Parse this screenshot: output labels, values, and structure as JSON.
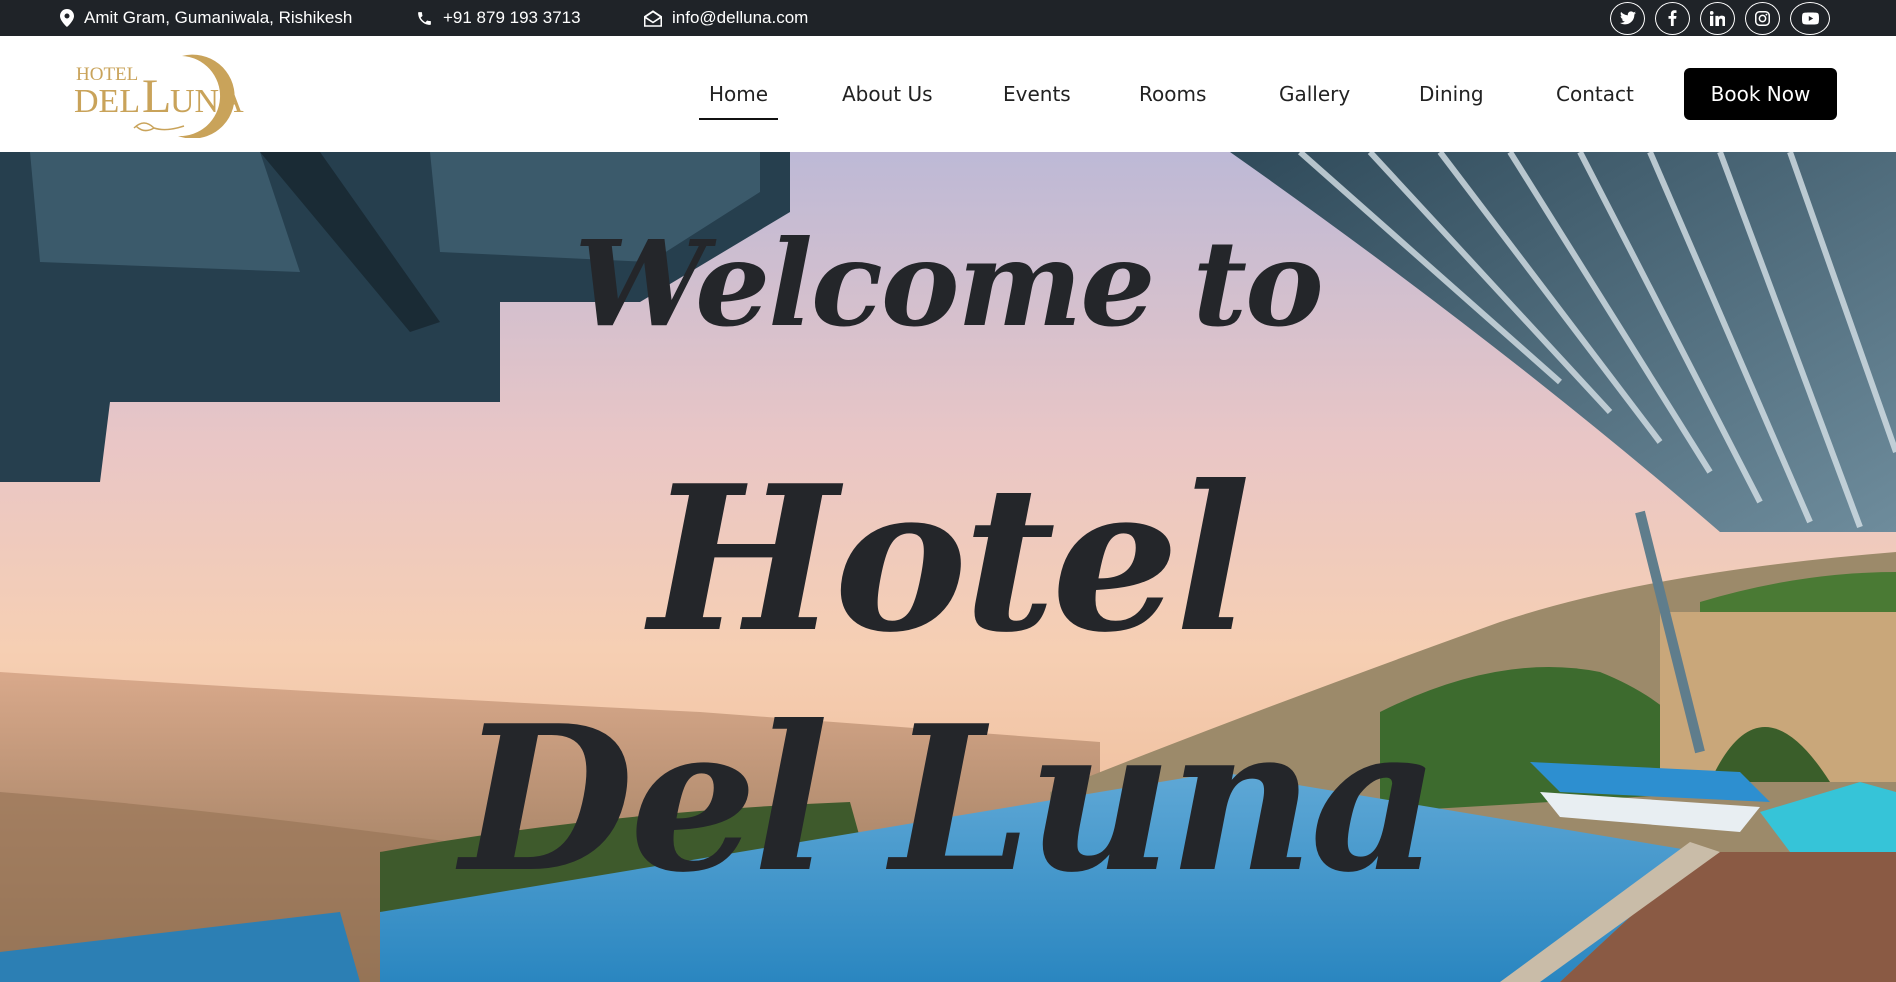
{
  "topbar": {
    "address": "Amit Gram, Gumaniwala, Rishikesh",
    "phone": "+91 879 193 3713",
    "email": "info@delluna.com",
    "socials": [
      "twitter-icon",
      "facebook-icon",
      "linkedin-icon",
      "instagram-icon",
      "youtube-icon"
    ]
  },
  "logo": {
    "line1": "HOTEL",
    "line2": "DEL LUNA"
  },
  "nav": {
    "items": [
      "Home",
      "About Us",
      "Events",
      "Rooms",
      "Gallery",
      "Dining",
      "Contact"
    ],
    "active": "Home",
    "book_label": "Book Now"
  },
  "hero": {
    "line1": "Welcome to",
    "line2": "Hotel",
    "line3": "Del Luna"
  },
  "colors": {
    "topbar_bg": "#1f2328",
    "logo_gold": "#c9a35a",
    "button_bg": "#000000",
    "hero_text": "#24262a"
  }
}
